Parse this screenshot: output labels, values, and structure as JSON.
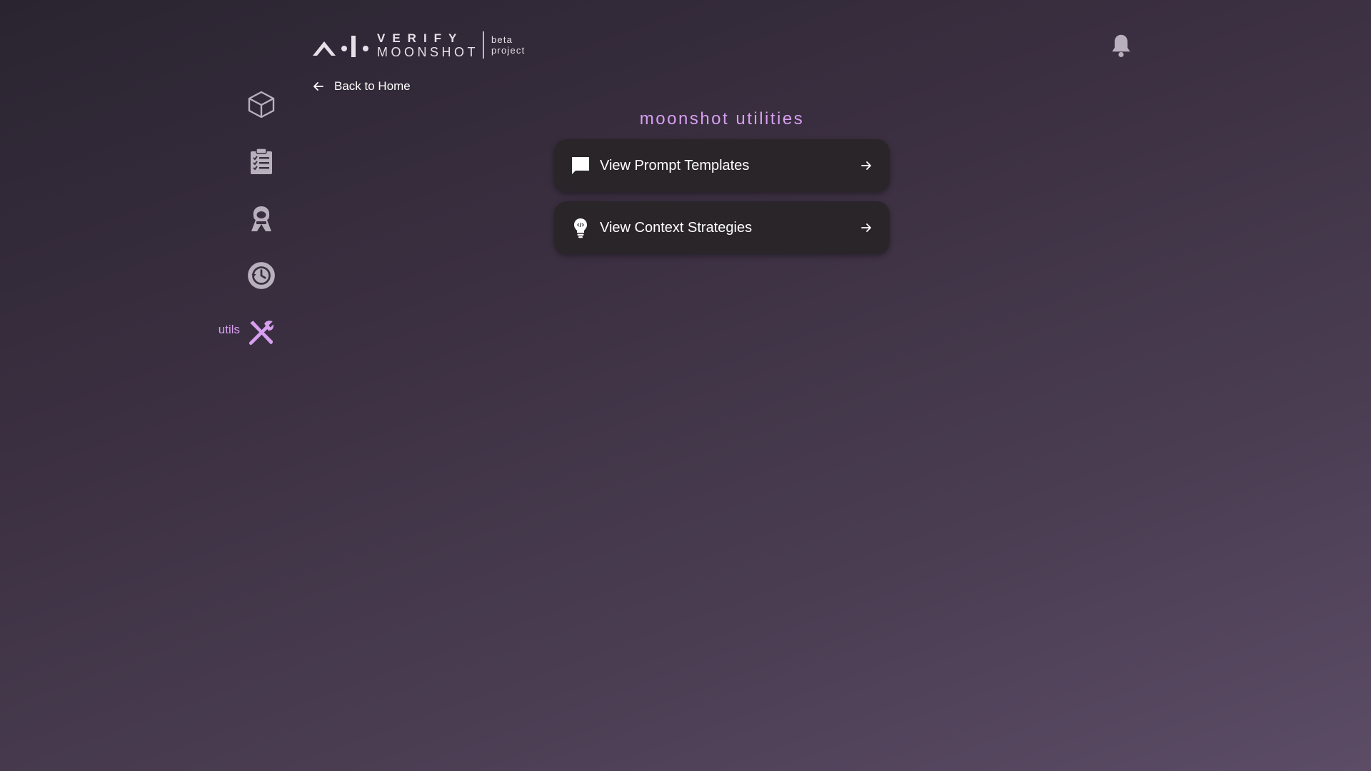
{
  "header": {
    "logo_verify": "VERIFY",
    "logo_moonshot": "MOONSHOT",
    "logo_beta": "beta",
    "logo_project": "project"
  },
  "back_link": {
    "label": "Back to Home"
  },
  "page": {
    "title": "moonshot utilities"
  },
  "sidebar": {
    "items": [
      {
        "icon": "cube-icon",
        "label": ""
      },
      {
        "icon": "clipboard-checklist-icon",
        "label": ""
      },
      {
        "icon": "red-team-agent-icon",
        "label": ""
      },
      {
        "icon": "history-icon",
        "label": ""
      },
      {
        "icon": "tools-icon",
        "label": "utils",
        "active": true
      }
    ]
  },
  "cards": [
    {
      "icon": "chat-bubble-icon",
      "label": "View Prompt Templates"
    },
    {
      "icon": "lightbulb-icon",
      "label": "View Context Strategies"
    }
  ],
  "colors": {
    "accent": "#d79ff0",
    "icon_gray": "#b8b0bd",
    "card_bg": "#2a2529"
  }
}
